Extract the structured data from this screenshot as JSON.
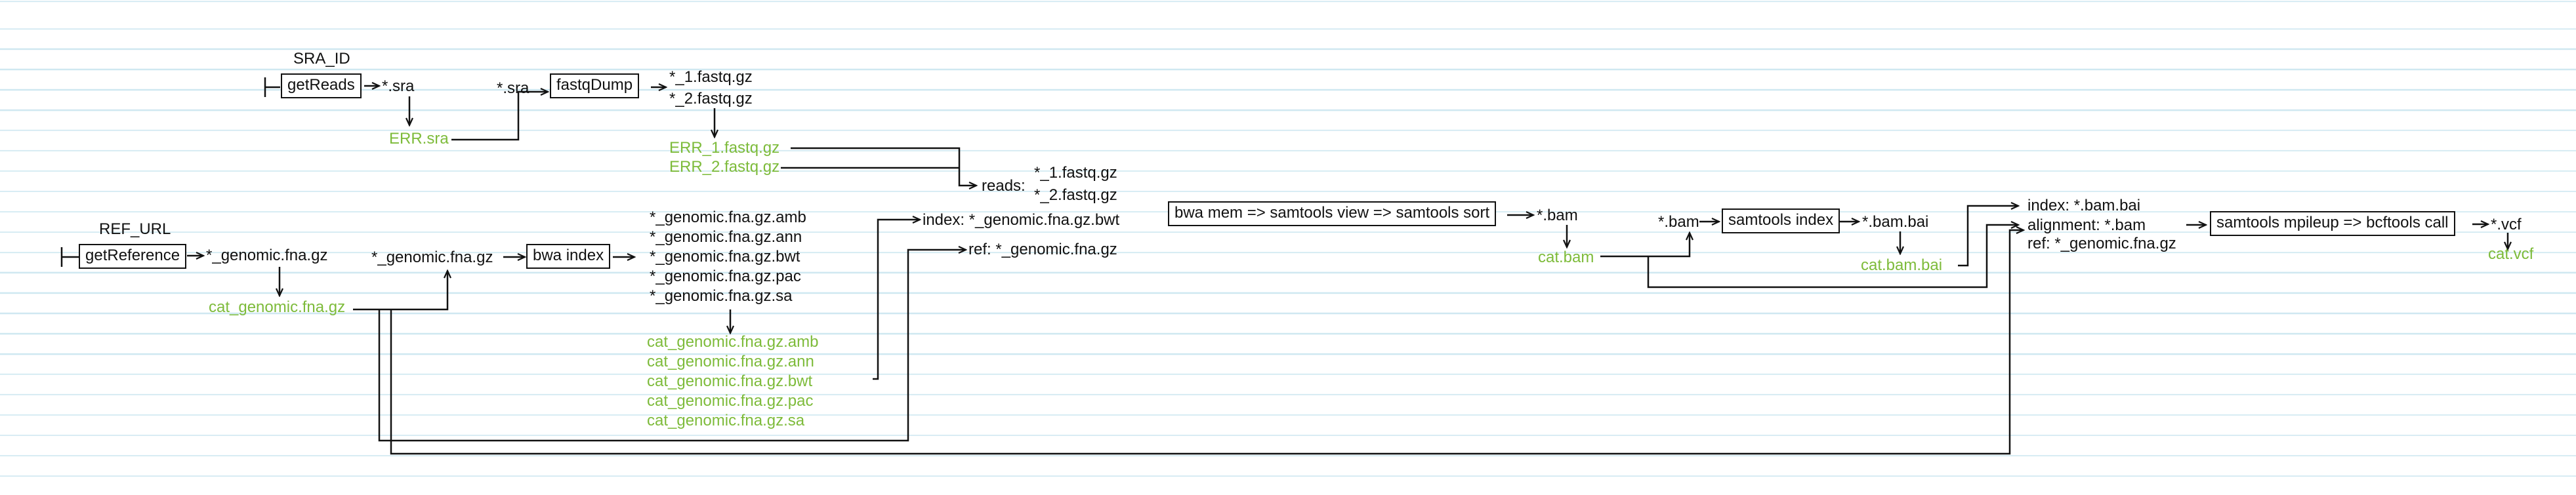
{
  "sources": {
    "sra_id": "SRA_ID",
    "ref_url": "REF_URL"
  },
  "processes": {
    "get_reads": "getReads",
    "fastq_dump": "fastqDump",
    "get_reference": "getReference",
    "bwa_index": "bwa index",
    "align": "bwa mem => samtools view => samtools sort",
    "samtools_index": "samtools index",
    "call": "samtools mpileup => bcftools call"
  },
  "channels": {
    "sra_out": "*.sra",
    "sra_in": "*.sra",
    "fastq_out": [
      "*_1.fastq.gz",
      "*_2.fastq.gz"
    ],
    "fasta_out": "*_genomic.fna.gz",
    "fasta_in": "*_genomic.fna.gz",
    "index_out": [
      "*_genomic.fna.gz.amb",
      "*_genomic.fna.gz.ann",
      "*_genomic.fna.gz.bwt",
      "*_genomic.fna.gz.pac",
      "*_genomic.fna.gz.sa"
    ],
    "reads_label": "reads:",
    "reads_files": [
      "*_1.fastq.gz",
      "*_2.fastq.gz"
    ],
    "align_index": "index: *_genomic.fna.gz.bwt",
    "align_ref": "ref: *_genomic.fna.gz",
    "bam_out": "*.bam",
    "bam_in": "*.bam",
    "bai_out": "*.bam.bai",
    "call_index": "index: *.bam.bai",
    "call_alignment": "alignment: *.bam",
    "call_ref": "ref: *_genomic.fna.gz",
    "vcf_out": "*.vcf"
  },
  "published": {
    "err_sra": "ERR.sra",
    "err_fastq": [
      "ERR_1.fastq.gz",
      "ERR_2.fastq.gz"
    ],
    "cat_genomic": "cat_genomic.fna.gz",
    "cat_index": [
      "cat_genomic.fna.gz.amb",
      "cat_genomic.fna.gz.ann",
      "cat_genomic.fna.gz.bwt",
      "cat_genomic.fna.gz.pac",
      "cat_genomic.fna.gz.sa"
    ],
    "cat_bam": "cat.bam",
    "cat_bai": "cat.bam.bai",
    "cat_vcf": "cat.vcf"
  },
  "colors": {
    "published_file": "#7dbb3a",
    "line": "#111111",
    "ruled_lines": "#cfe8f1"
  }
}
